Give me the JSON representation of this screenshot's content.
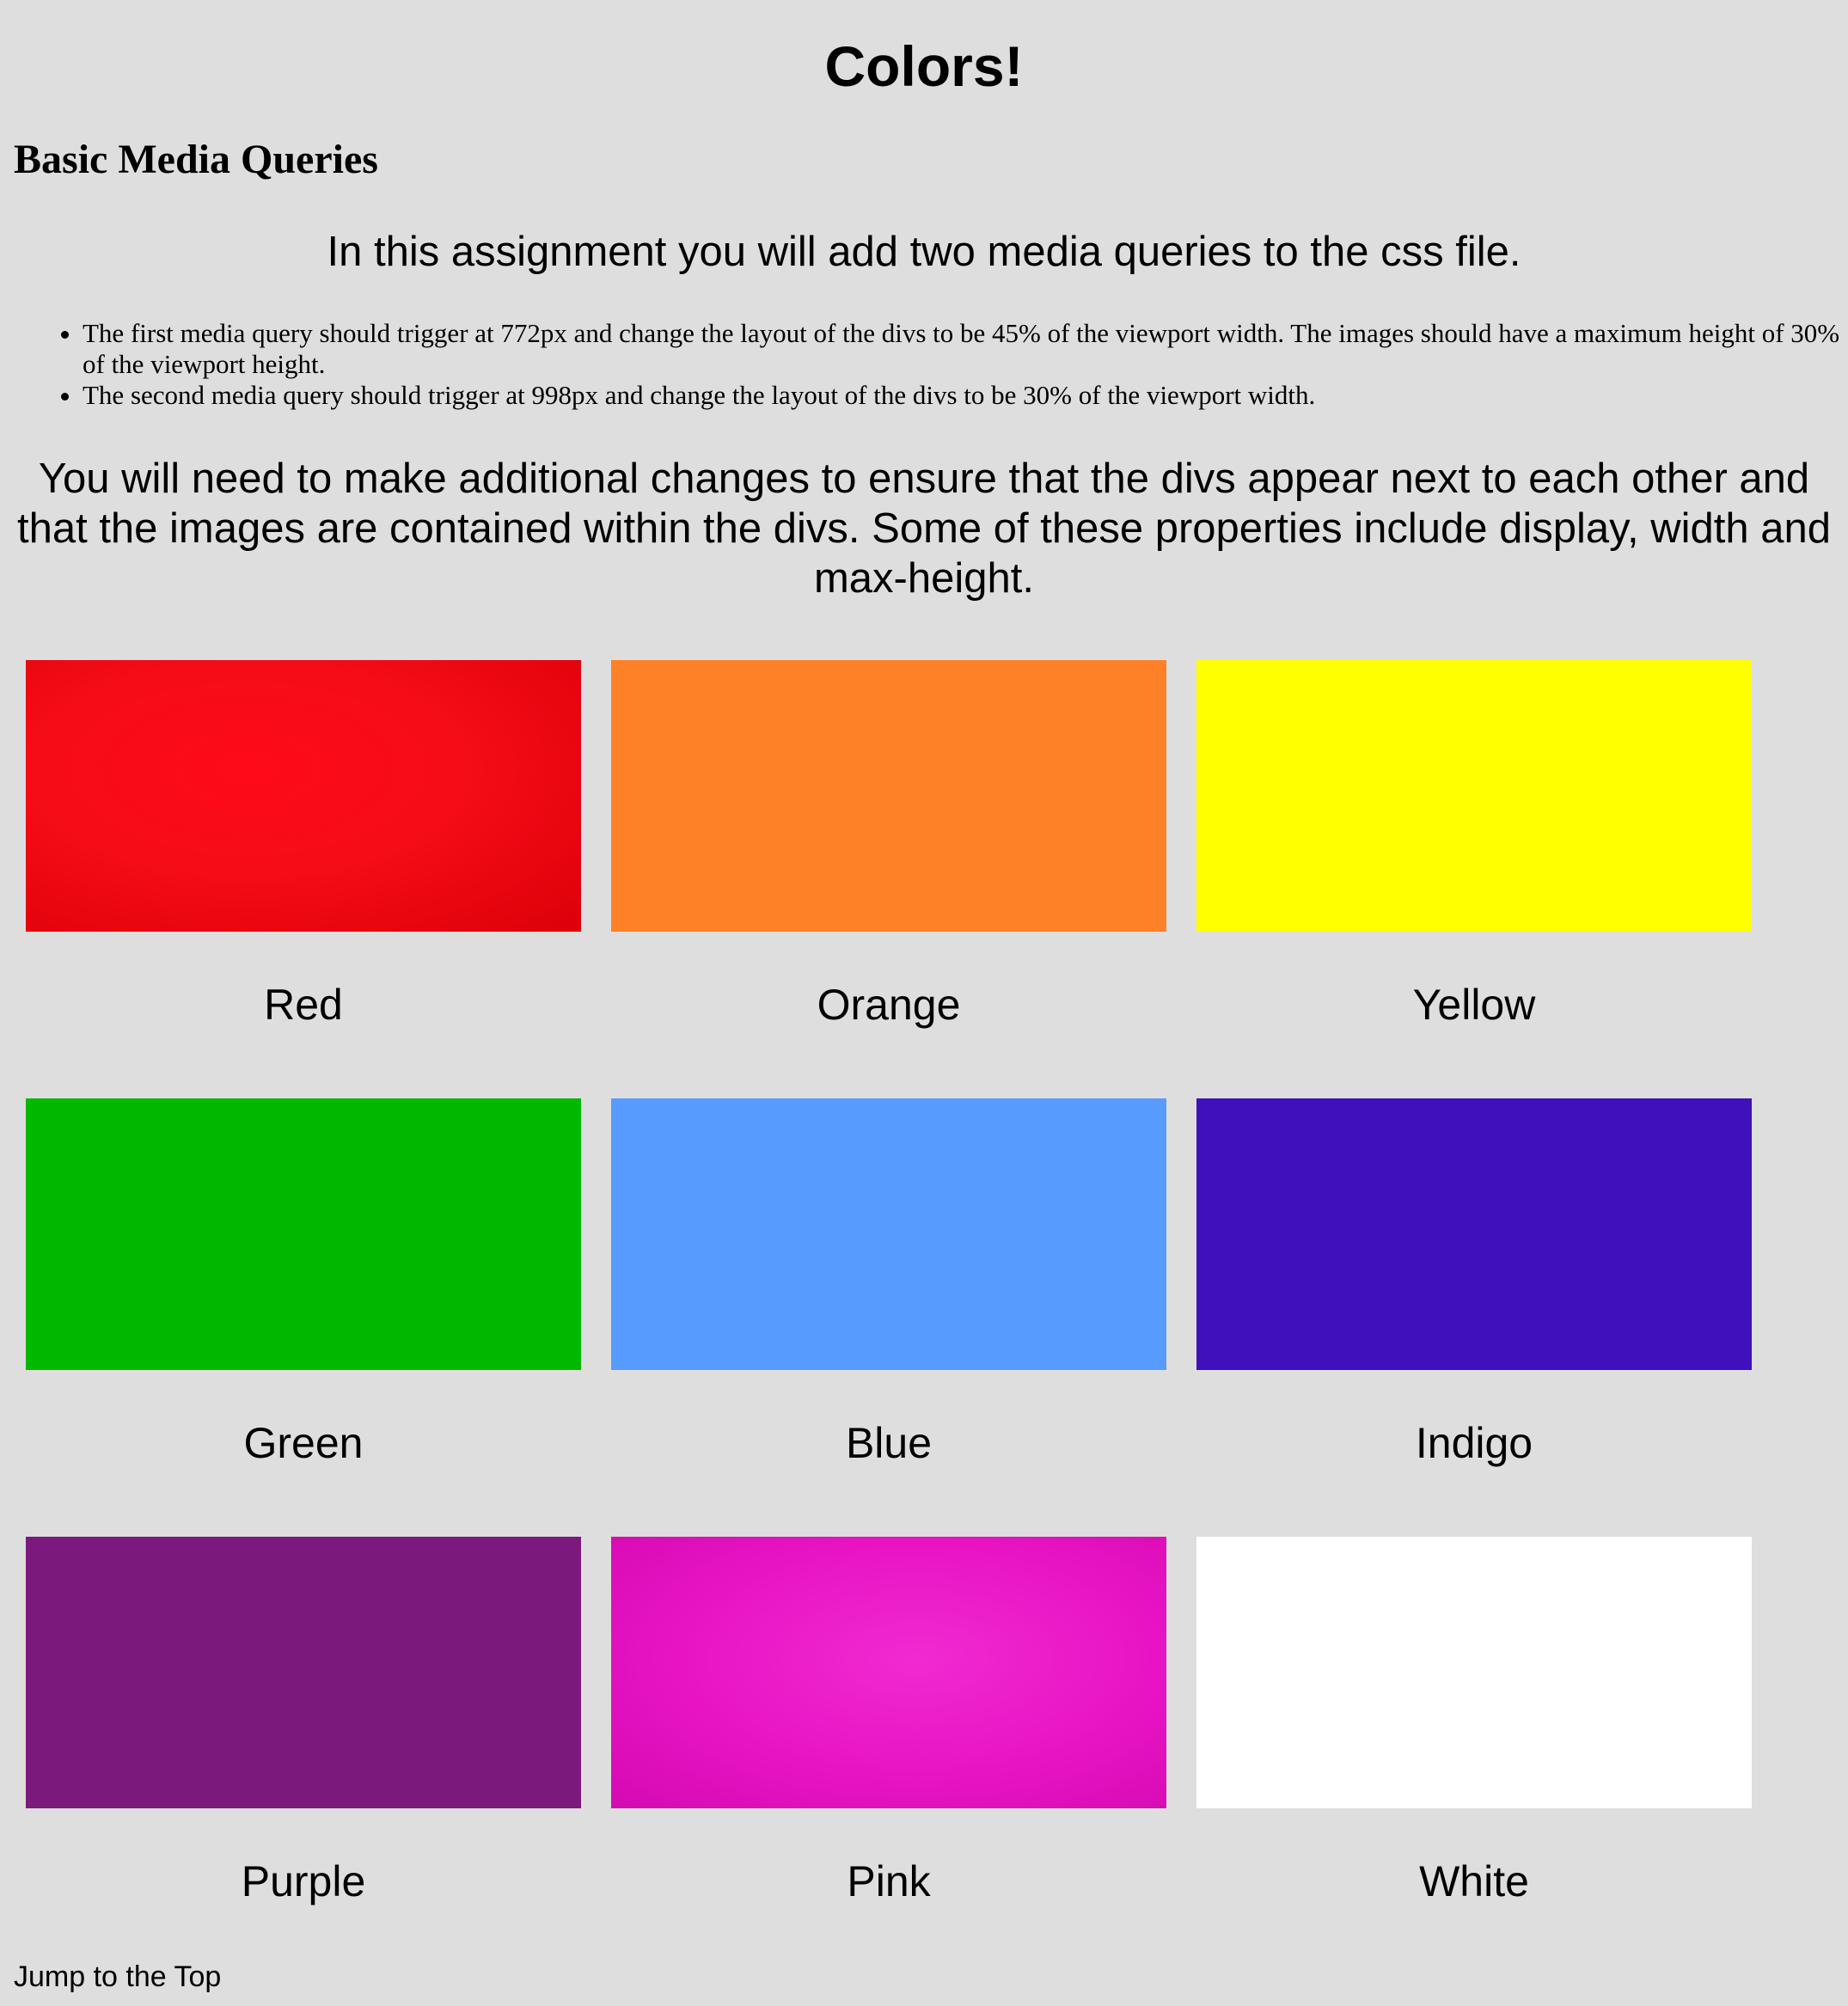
{
  "header": {
    "title": "Colors!",
    "subtitle": "Basic Media Queries"
  },
  "intro": "In this assignment you will add two media queries to the css file.",
  "bullets": [
    "The first media query should trigger at 772px and change the layout of the divs to be 45% of the viewport width. The images should have a maximum height of 30% of the viewport height.",
    "The second media query should trigger at 998px and change the layout of the divs to be 30% of the viewport width."
  ],
  "instruction": "You will need to make additional changes to ensure that the divs appear next to each other and that the images are contained within the divs. Some of these properties include display, width and max-height.",
  "colors": [
    {
      "label": "Red",
      "color": "#f0101e"
    },
    {
      "label": "Orange",
      "color": "#fe8027"
    },
    {
      "label": "Yellow",
      "color": "#ffff00"
    },
    {
      "label": "Green",
      "color": "#00b800"
    },
    {
      "label": "Blue",
      "color": "#579bff"
    },
    {
      "label": "Indigo",
      "color": "#3f10bb"
    },
    {
      "label": "Purple",
      "color": "#7b197c"
    },
    {
      "label": "Pink",
      "color": "#e814c4"
    },
    {
      "label": "White",
      "color": "#ffffff"
    }
  ],
  "footer": {
    "jump_link": "Jump to the Top"
  }
}
